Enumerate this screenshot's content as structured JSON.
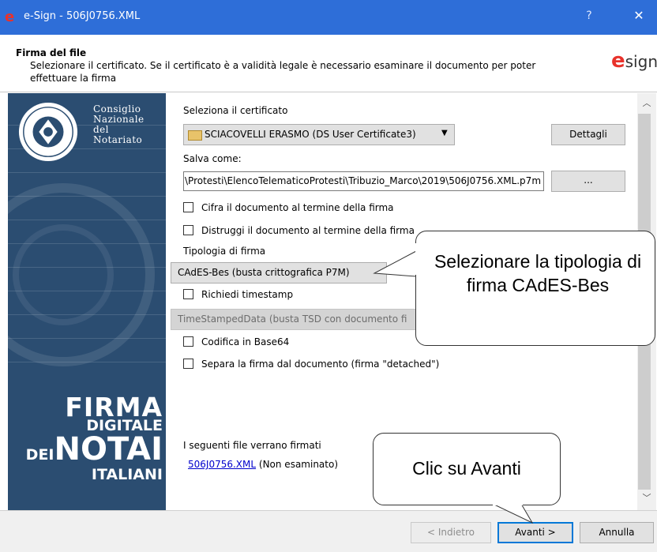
{
  "window": {
    "title": "e-Sign - 506J0756.XML",
    "help_label": "?",
    "close_label": "✕"
  },
  "header": {
    "title": "Firma del file",
    "description": "Selezionare il certificato. Se il certificato è a validità legale è necessario esaminare il documento per poter effettuare la firma",
    "brand_e": "e",
    "brand_rest": "sign"
  },
  "sidebar": {
    "org_name": [
      "Consiglio",
      "Nazionale",
      "del",
      "Notariato"
    ],
    "firma": "FIRMA",
    "digitale": "DIGITALE",
    "dei": "DEI",
    "notai": "NOTAI",
    "italiani": "ITALIANI"
  },
  "form": {
    "cert_label": "Seleziona il certificato",
    "cert_value": "SCIACOVELLI ERASMO (DS User Certificate3)",
    "dettagli_label": "Dettagli",
    "save_label": "Salva come:",
    "save_path": "\\Protesti\\ElencoTelematicoProtesti\\Tribuzio_Marco\\2019\\506J0756.XML.p7m",
    "browse_label": "...",
    "cifra_label": "Cifra il documento al termine della firma",
    "distruggi_label": "Distruggi il documento al termine della firma",
    "tipologia_label": "Tipologia di firma",
    "tipologia_value": "CAdES-Bes (busta crittografica P7M)",
    "timestamp_label": "Richiedi timestamp",
    "timestamp_type": "TimeStampedData (busta TSD con documento fi",
    "base64_label": "Codifica in Base64",
    "separa_label": "Separa la firma dal documento (firma \"detached\")",
    "files_label": "I seguenti file verrano firmati",
    "file_link": "506J0756.XML",
    "file_status": "(Non esaminato)"
  },
  "checkboxes": {
    "cifra": false,
    "distruggi": false,
    "timestamp": false,
    "base64": false,
    "separa": false
  },
  "buttons": {
    "indietro": "< Indietro",
    "avanti": "Avanti >",
    "annulla": "Annulla"
  },
  "callouts": {
    "tipologia": "Selezionare la tipologia di firma CAdES-Bes",
    "avanti": "Clic su Avanti"
  }
}
